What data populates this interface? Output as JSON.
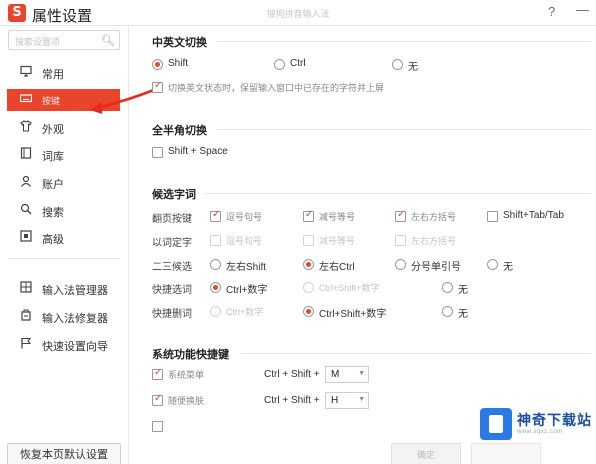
{
  "titlebar": {
    "logo": "S",
    "title": "属性设置",
    "center_title": "搜狗拼音输入法",
    "help": "?",
    "minimize": "—"
  },
  "sidebar": {
    "search_placeholder": "搜索设置项",
    "items": [
      {
        "label": "常用",
        "icon": "monitor-icon"
      },
      {
        "label": "按键",
        "icon": "keyboard-icon"
      },
      {
        "label": "外观",
        "icon": "shirt-icon"
      },
      {
        "label": "词库",
        "icon": "book-icon"
      },
      {
        "label": "账户",
        "icon": "user-icon"
      },
      {
        "label": "搜索",
        "icon": "search-icon"
      },
      {
        "label": "高级",
        "icon": "advanced-icon"
      }
    ],
    "tools": [
      {
        "label": "输入法管理器",
        "icon": "manager-icon"
      },
      {
        "label": "输入法修复器",
        "icon": "repair-icon"
      },
      {
        "label": "快速设置向导",
        "icon": "flag-icon"
      }
    ],
    "restore_label": "恢复本页默认设置"
  },
  "cn_en_switch": {
    "title": "中英文切换",
    "options": [
      "Shift",
      "Ctrl",
      "无"
    ],
    "keep_input": "切换英文状态时，保留输入窗口中已存在的字符并上屏"
  },
  "full_half": {
    "title": "全半角切换",
    "option": "Shift + Space"
  },
  "candidate": {
    "title": "候选字词",
    "page_label": "翻页按键",
    "page_opts": [
      "逗号句号",
      "减号等号",
      "左右方括号",
      "Shift+Tab/Tab"
    ],
    "word_label": "以词定字",
    "word_opts": [
      "逗号句号",
      "减号等号",
      "左右方括号"
    ],
    "sel23_label": "二三候选",
    "sel23_opts": [
      "左右Shift",
      "左右Ctrl",
      "分号单引号",
      "无"
    ],
    "quick_sel_label": "快捷选词",
    "quick_sel_opts": [
      "Ctrl+数字",
      "Ctrl+Shift+数字",
      "无"
    ],
    "quick_del_label": "快捷删词",
    "quick_del_opts": [
      "Ctrl+数字",
      "Ctrl+Shift+数字",
      "无"
    ]
  },
  "hotkeys": {
    "title": "系统功能快捷键",
    "items": [
      {
        "label": "系统菜单",
        "combo": "Ctrl + Shift +",
        "key": "M"
      },
      {
        "label": "随便换肤",
        "combo": "Ctrl + Shift +",
        "key": "H"
      }
    ]
  },
  "footer": {
    "ok": "确定"
  },
  "watermark": {
    "name": "神奇下载站",
    "url": "www.sqxz.com"
  },
  "colors": {
    "accent": "#e8452c",
    "watermark": "#2a7be4"
  }
}
